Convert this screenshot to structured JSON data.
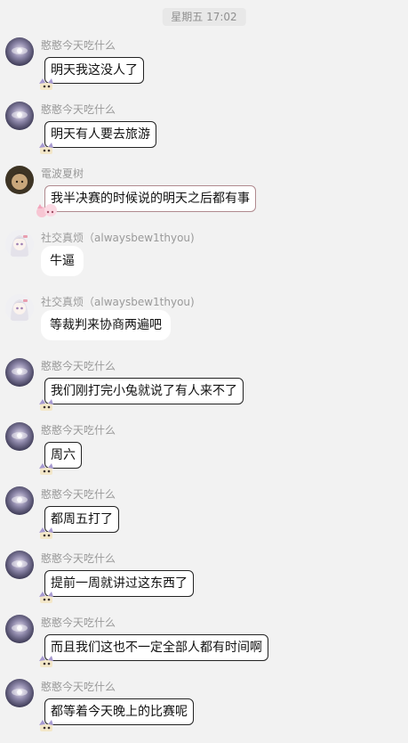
{
  "header": {
    "time": "星期五 17:02"
  },
  "messages": [
    {
      "name": "憨憨今天吃什么",
      "text": "明天我这没人了",
      "avatar": "galaxy-avatar",
      "style": "boxed"
    },
    {
      "name": "憨憨今天吃什么",
      "text": "明天有人要去旅游",
      "avatar": "galaxy-avatar",
      "style": "boxed"
    },
    {
      "name": "電波夏树",
      "text": "我半决赛的时候说的明天之后都有事",
      "avatar": "anime-avatar",
      "style": "boxed-pink"
    },
    {
      "name": "社交真烦（alwaysbew1thyou)",
      "text": "牛逼",
      "avatar": "white-hair-avatar",
      "style": "plain"
    },
    {
      "name": "社交真烦（alwaysbew1thyou)",
      "text": "等裁判来协商两遍吧",
      "avatar": "white-hair-avatar",
      "style": "plain"
    },
    {
      "name": "憨憨今天吃什么",
      "text": "我们刚打完小兔就说了有人来不了",
      "avatar": "galaxy-avatar",
      "style": "boxed"
    },
    {
      "name": "憨憨今天吃什么",
      "text": "周六",
      "avatar": "galaxy-avatar",
      "style": "boxed"
    },
    {
      "name": "憨憨今天吃什么",
      "text": "都周五打了",
      "avatar": "galaxy-avatar",
      "style": "boxed"
    },
    {
      "name": "憨憨今天吃什么",
      "text": "提前一周就讲过这东西了",
      "avatar": "galaxy-avatar",
      "style": "boxed"
    },
    {
      "name": "憨憨今天吃什么",
      "text": "而且我们这也不一定全部人都有时间啊",
      "avatar": "galaxy-avatar",
      "style": "boxed"
    },
    {
      "name": "憨憨今天吃什么",
      "text": "都等着今天晚上的比赛呢",
      "avatar": "galaxy-avatar",
      "style": "boxed"
    }
  ]
}
